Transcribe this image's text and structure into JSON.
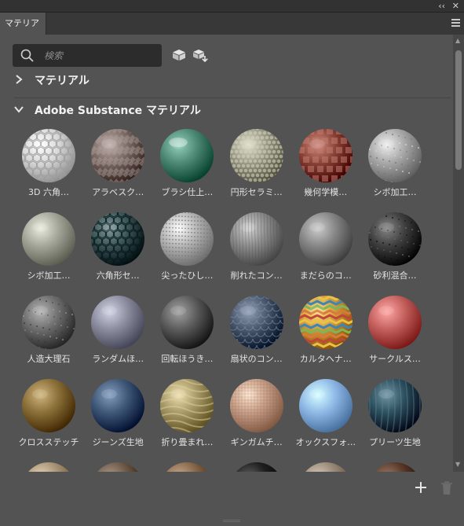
{
  "window": {
    "collapse_glyph": "‹‹",
    "close_glyph": "✕"
  },
  "tabs": [
    {
      "label": "マテリアル"
    }
  ],
  "search": {
    "placeholder": "検索",
    "value": ""
  },
  "sections": [
    {
      "label": "マテリアル",
      "expanded": false
    },
    {
      "label": "Adobe Substance マテリアル",
      "expanded": true
    }
  ],
  "materials": [
    {
      "name": "3D 六角…",
      "color": "#d9d9d9",
      "pattern": "hex"
    },
    {
      "name": "アラベスク…",
      "color": "#7b6a66",
      "pattern": "weave"
    },
    {
      "name": "ブラシ仕上…",
      "color": "#4f8a76",
      "pattern": "glossy"
    },
    {
      "name": "円形セラミ…",
      "color": "#9a9a86",
      "pattern": "dots"
    },
    {
      "name": "幾何学模…",
      "color": "#8a4438",
      "pattern": "blocks"
    },
    {
      "name": "シボ加工…",
      "color": "#a8a8a8",
      "pattern": "speckle"
    },
    {
      "name": "シボ加工…",
      "color": "#a4a699",
      "pattern": "plain"
    },
    {
      "name": "六角形セ…",
      "color": "#3e5558",
      "pattern": "hexdark"
    },
    {
      "name": "尖ったひし…",
      "color": "#b5b5b5",
      "pattern": "spikes"
    },
    {
      "name": "削れたコン…",
      "color": "#8c8c8c",
      "pattern": "streak"
    },
    {
      "name": "まだらのコ…",
      "color": "#868686",
      "pattern": "plain"
    },
    {
      "name": "砂利混合…",
      "color": "#3f3f3f",
      "pattern": "speckle"
    },
    {
      "name": "人造大理石",
      "color": "#6e6e6e",
      "pattern": "speckle"
    },
    {
      "name": "ランダムほ…",
      "color": "#8c8d9e",
      "pattern": "plain"
    },
    {
      "name": "回転ほうき…",
      "color": "#5c5c5c",
      "pattern": "plain"
    },
    {
      "name": "扇状のコン…",
      "color": "#4c5a70",
      "pattern": "scales"
    },
    {
      "name": "カルタヘナ…",
      "color": "#d49a3a",
      "pattern": "chevron"
    },
    {
      "name": "サークルス…",
      "color": "#c4615f",
      "pattern": "plain"
    },
    {
      "name": "クロスステッチ",
      "color": "#8a7038",
      "pattern": "plain"
    },
    {
      "name": "ジーンズ生地",
      "color": "#3f5878",
      "pattern": "plain"
    },
    {
      "name": "折り畳まれ…",
      "color": "#a89a68",
      "pattern": "folds"
    },
    {
      "name": "ギンガムチ…",
      "color": "#c9a08a",
      "pattern": "grid"
    },
    {
      "name": "オックスフォ…",
      "color": "#8fb8e6",
      "pattern": "plain"
    },
    {
      "name": "プリーツ生地",
      "color": "#2c4f5e",
      "pattern": "pleats"
    },
    {
      "name": "",
      "color": "#a89476",
      "pattern": "plain"
    },
    {
      "name": "",
      "color": "#6e5a48",
      "pattern": "plain"
    },
    {
      "name": "",
      "color": "#8a6a4c",
      "pattern": "plain"
    },
    {
      "name": "",
      "color": "#1e1e1e",
      "pattern": "plain"
    },
    {
      "name": "",
      "color": "#9a8a7a",
      "pattern": "plain"
    },
    {
      "name": "",
      "color": "#5a3a2a",
      "pattern": "plain"
    }
  ],
  "footer": {
    "add_glyph": "+",
    "delete_label": "delete"
  }
}
